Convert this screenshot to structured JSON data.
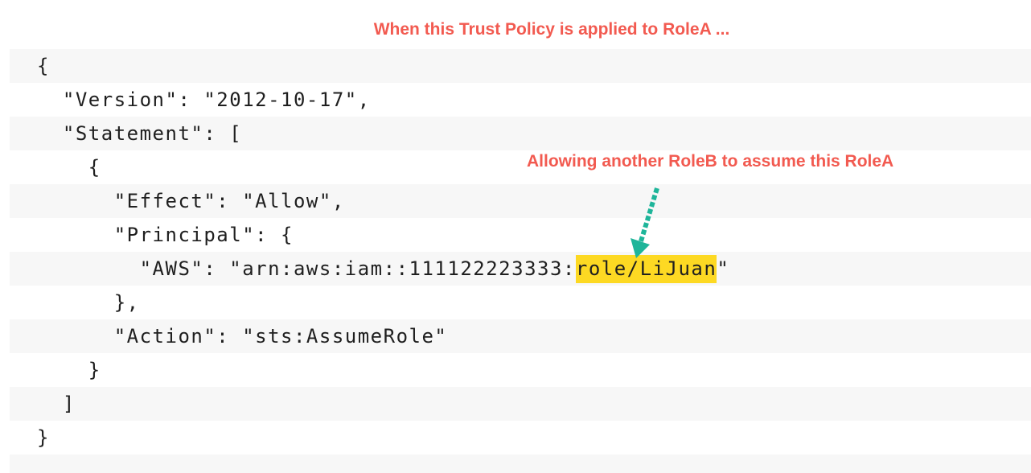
{
  "title": "When this Trust Policy is applied to RoleA ...",
  "annotation": "Allowing another RoleB to assume this RoleA",
  "accent_color": "#f25a50",
  "arrow_color": "#1eb59a",
  "highlight_color": "#fdd923",
  "code": {
    "lines": [
      "{",
      "  \"Version\": \"2012-10-17\",",
      "  \"Statement\": [",
      "    {",
      "      \"Effect\": \"Allow\",",
      "      \"Principal\": {",
      "        \"AWS\": \"arn:aws:iam::111122223333:",
      "      },",
      "      \"Action\": \"sts:AssumeRole\"",
      "    }",
      "  ]",
      "}"
    ],
    "highlight": "role/LiJuan",
    "highlight_suffix": "\""
  }
}
